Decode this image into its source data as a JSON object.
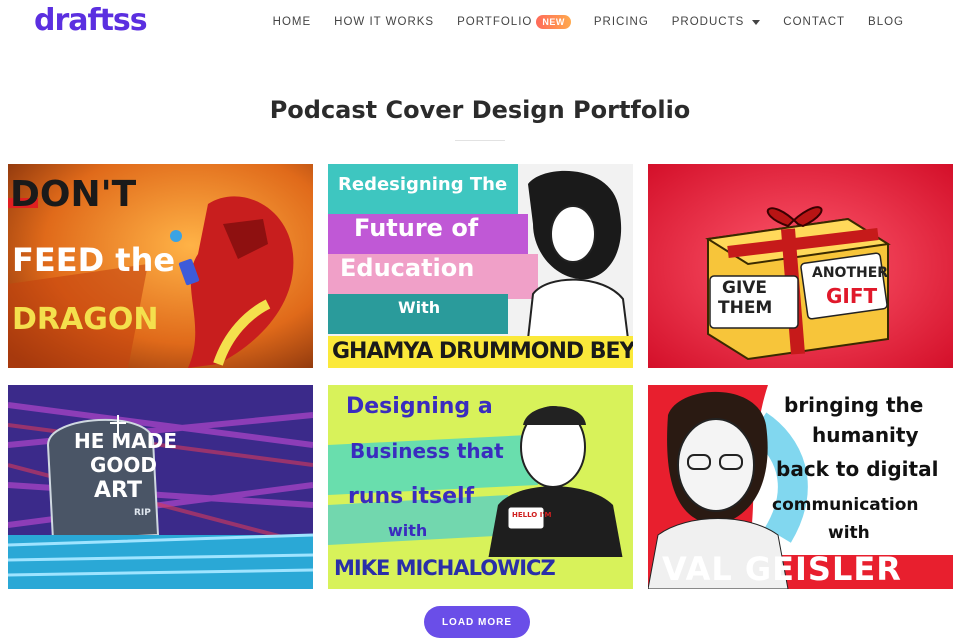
{
  "header": {
    "logo_text": "draftss",
    "nav": [
      {
        "label": "HOME"
      },
      {
        "label": "HOW IT WORKS"
      },
      {
        "label": "PORTFOLIO",
        "badge": "NEW"
      },
      {
        "label": "PRICING"
      },
      {
        "label": "PRODUCTS"
      },
      {
        "label": "CONTACT"
      },
      {
        "label": "BLOG"
      }
    ],
    "brand_color": "#5b2fe0"
  },
  "main": {
    "title": "Podcast Cover Design Portfolio",
    "load_more_label": "LOAD MORE",
    "accent_color": "#6a4ee8"
  },
  "portfolio": [
    {
      "lines": [
        "DON'T",
        "FEED the",
        "DRAGON"
      ]
    },
    {
      "lines": [
        "Redesigning The",
        "Future of",
        "Education",
        "With",
        "GHAMYA DRUMMOND BEY"
      ]
    },
    {
      "lines": [
        "GIVE",
        "THEM",
        "ANOTHER",
        "GIFT"
      ]
    },
    {
      "lines": [
        "HE MADE",
        "GOOD",
        "ART",
        "RIP"
      ]
    },
    {
      "lines": [
        "Designing a",
        "Business that",
        "runs itself",
        "with",
        "MIKE MICHALOWICZ",
        "HELLO I'M"
      ]
    },
    {
      "lines": [
        "bringing the",
        "humanity",
        "back to digital",
        "communication",
        "with",
        "VAL GEISLER"
      ]
    }
  ]
}
